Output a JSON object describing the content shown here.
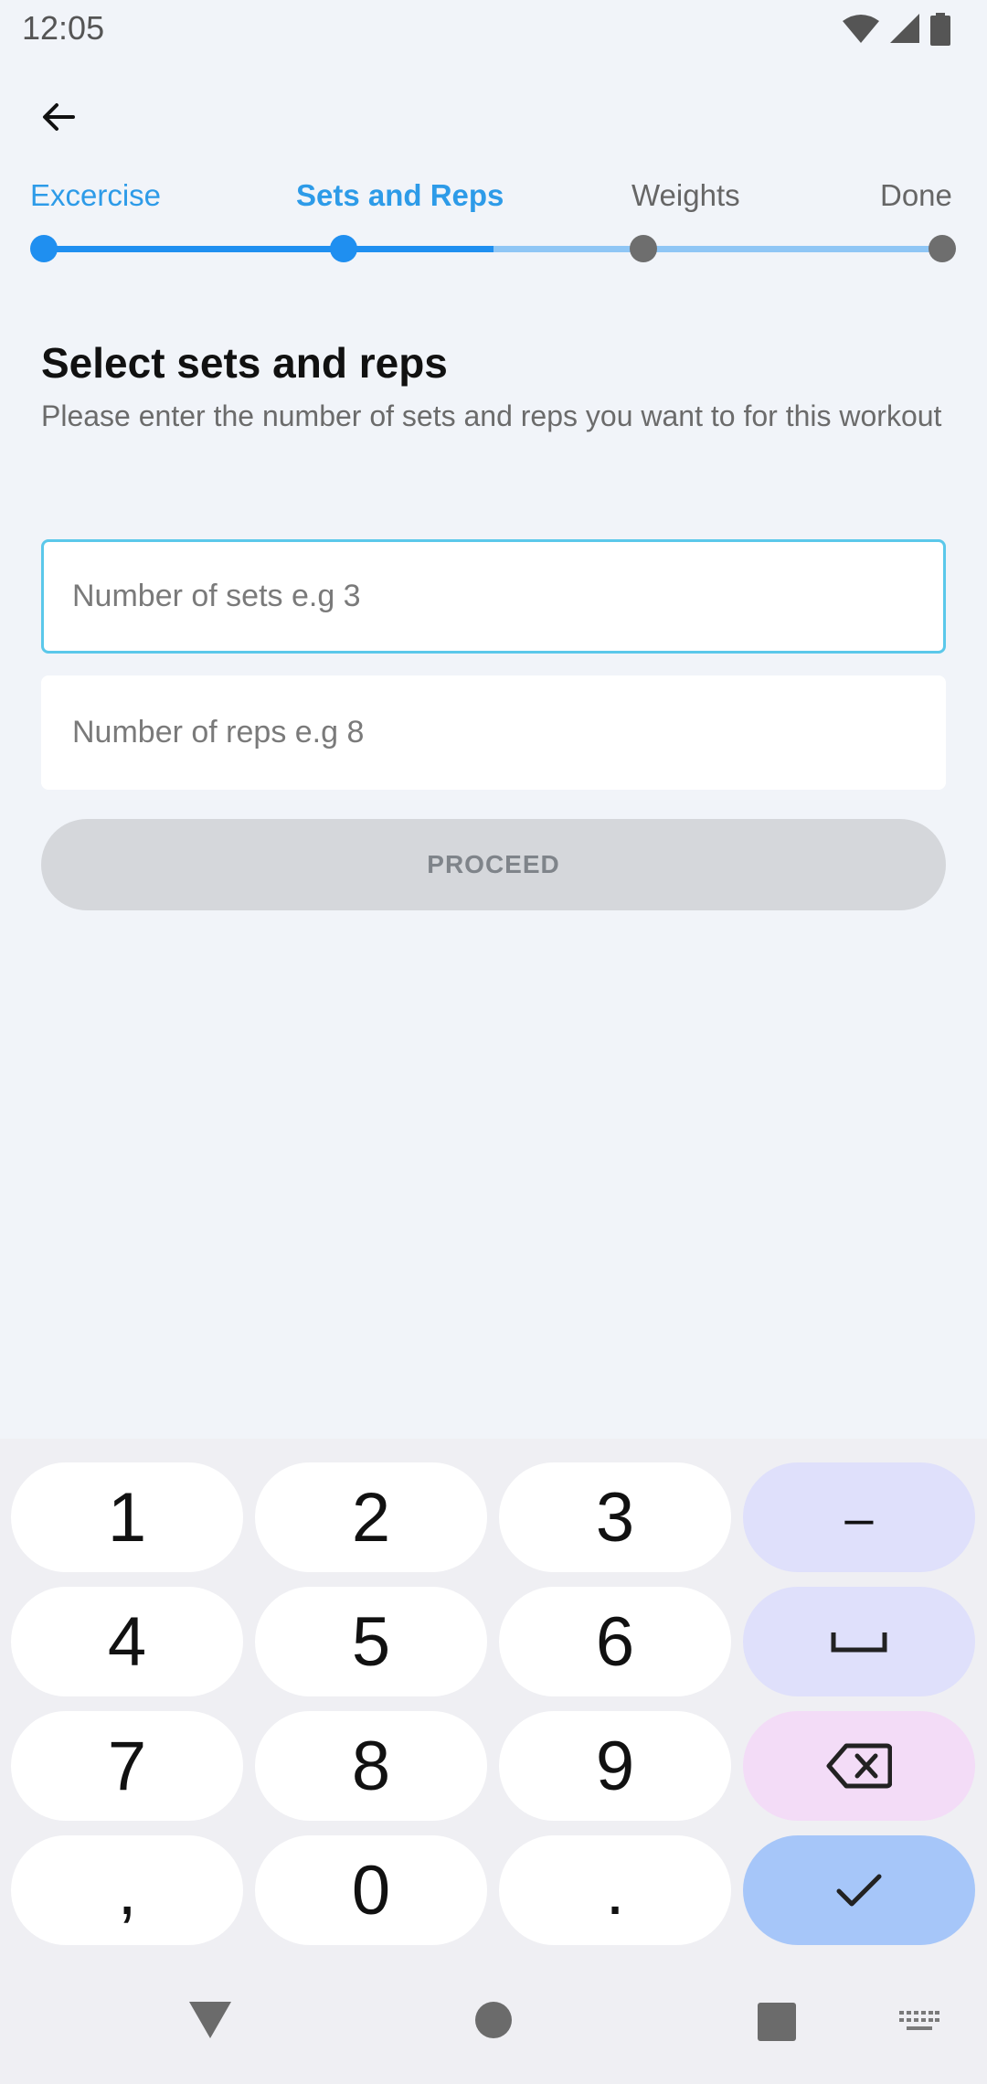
{
  "status_bar": {
    "time": "12:05",
    "icons": [
      "wifi-icon",
      "signal-icon",
      "battery-icon"
    ]
  },
  "app_bar": {
    "back_icon": "arrow-left-icon"
  },
  "stepper": {
    "steps": [
      {
        "label": "Excercise",
        "state": "done"
      },
      {
        "label": "Sets and Reps",
        "state": "current"
      },
      {
        "label": "Weights",
        "state": "upcoming"
      },
      {
        "label": "Done",
        "state": "upcoming"
      }
    ],
    "colors": {
      "active": "#1f8ff0",
      "inactive_track": "#8fc6f5",
      "inactive_dot": "#6e6e6e",
      "label_active": "#2d9be8",
      "label_inactive": "#666666"
    }
  },
  "content": {
    "title": "Select sets and reps",
    "subtitle": "Please enter the number of sets and reps you want to for this workout",
    "sets_field": {
      "placeholder": "Number of sets e.g 3",
      "value": ""
    },
    "reps_field": {
      "placeholder": "Number of reps e.g 8",
      "value": ""
    },
    "proceed_label": "PROCEED"
  },
  "keyboard": {
    "rows": [
      [
        "1",
        "2",
        "3",
        "–"
      ],
      [
        "4",
        "5",
        "6",
        "space"
      ],
      [
        "7",
        "8",
        "9",
        "backspace"
      ],
      [
        ",",
        "0",
        ".",
        "enter"
      ]
    ],
    "keys": {
      "k1": "1",
      "k2": "2",
      "k3": "3",
      "k4": "4",
      "k5": "5",
      "k6": "6",
      "k7": "7",
      "k8": "8",
      "k9": "9",
      "k0": "0",
      "comma": ",",
      "period": ".",
      "minus": "–"
    },
    "icons": {
      "space": "space-bar-icon",
      "backspace": "backspace-icon",
      "enter": "checkmark-icon"
    }
  },
  "nav_bar": {
    "icons": [
      "back-triangle-icon",
      "home-circle-icon",
      "recents-square-icon",
      "keyboard-icon"
    ]
  }
}
